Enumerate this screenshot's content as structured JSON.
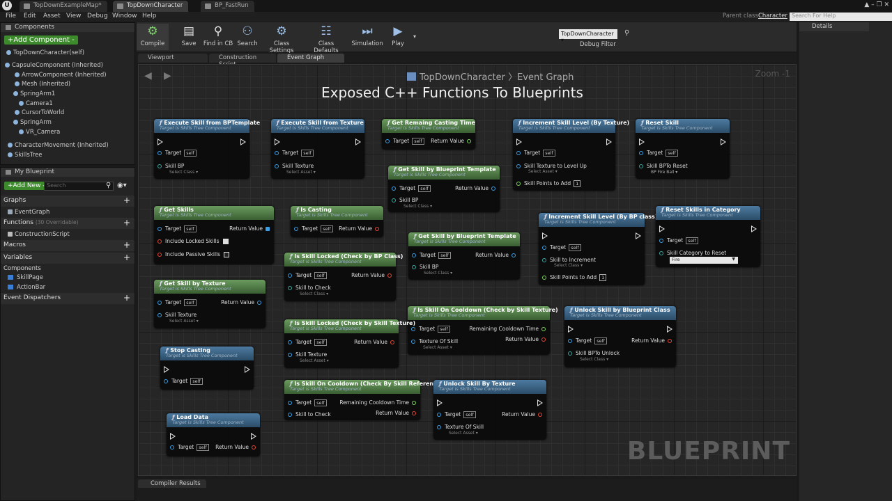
{
  "window": {
    "tabs": [
      "TopDownExampleMap*",
      "TopDownCharacter",
      "BP_FastRun"
    ],
    "controls": "▲ – ❐ ✕"
  },
  "menu": [
    "File",
    "Edit",
    "Asset",
    "View",
    "Debug",
    "Window",
    "Help"
  ],
  "parent_class_label": "Parent class:",
  "parent_class_value": "Character",
  "search_help_placeholder": "Search For Help",
  "components": {
    "title": "Components",
    "add_button": "+Add Component -",
    "items": [
      "TopDownCharacter(self)",
      "CapsuleComponent (Inherited)",
      "ArrowComponent (Inherited)",
      "Mesh (Inherited)",
      "SpringArm1",
      "Camera1",
      "CursorToWorld",
      "SpringArm",
      "VR_Camera",
      "CharacterMovement (Inherited)",
      "SkillsTree"
    ]
  },
  "my_blueprint": {
    "title": "My Blueprint",
    "add_new": "+Add New -",
    "search_placeholder": "Search",
    "graphs": "Graphs",
    "event_graph": "EventGraph",
    "functions": "Functions",
    "functions_sub": "(30 Overridable)",
    "construction_script": "ConstructionScript",
    "macros": "Macros",
    "variables": "Variables",
    "components": "Components",
    "vars": [
      "SkillPage",
      "ActionBar"
    ],
    "event_dispatchers": "Event Dispatchers"
  },
  "toolbar": {
    "compile": "Compile",
    "save": "Save",
    "find_in_cb": "Find in CB",
    "search": "Search",
    "class_settings": "Class Settings",
    "class_defaults": "Class Defaults",
    "simulation": "Simulation",
    "play": "Play",
    "debug_value": "TopDownCharacter ▾",
    "debug_label": "Debug Filter"
  },
  "editor_tabs": [
    "Viewport",
    "Construction Script",
    "Event Graph"
  ],
  "graph": {
    "breadcrumb": "TopDownCharacter 〉Event Graph",
    "zoom": "Zoom -1",
    "overlay_title": "Exposed C++ Functions To Blueprints",
    "watermark": "BLUEPRINT"
  },
  "node_subtitle": "Target is Skills Tree Component",
  "common": {
    "target": "Target",
    "self": "self",
    "return_value": "Return Value",
    "select_class": "Select Class ▾",
    "select_asset": "Select Asset ▾"
  },
  "nodes": {
    "execute_bp": {
      "title": "Execute Skill from BPTemplate",
      "pin": "Skill BP"
    },
    "execute_tex": {
      "title": "Execute Skill from Texture",
      "pin": "Skill Texture"
    },
    "remaining_time": {
      "title": "Get Remaing Casting Time"
    },
    "get_by_bp1": {
      "title": "Get Skill by Blueprint Template",
      "pin": "Skill BP"
    },
    "increment_tex": {
      "title": "Increment Skill Level (By Texture)",
      "pin1": "Skill Texture to Level Up",
      "pin2": "Skill Points to Add",
      "num": "1"
    },
    "reset_skill": {
      "title": "Reset Skill",
      "pin": "Skill BPTo Reset",
      "value": "BP Fire Ball ▾"
    },
    "get_skills": {
      "title": "Get Skills",
      "pin1": "Include Locked Skills",
      "pin2": "Include Passive Skills"
    },
    "is_casting": {
      "title": "Is Casting"
    },
    "increment_bp": {
      "title": "Increment Skill Level (By BP class)",
      "pin1": "Skill to Increment",
      "pin2": "Skill Points to Add",
      "num": "1"
    },
    "reset_category": {
      "title": "Reset Skills in Category",
      "pin": "Skill Category to Reset",
      "value": "Fire"
    },
    "get_by_bp2": {
      "title": "Get Skill by Blueprint Template",
      "pin": "Skill BP"
    },
    "locked_bp": {
      "title": "Is Skill Locked (Check by BP Class)",
      "pin": "Skill to Check"
    },
    "get_by_tex": {
      "title": "Get Skill by Texture",
      "pin": "Skill Texture"
    },
    "cooldown_tex": {
      "title": "Is Skill On Cooldown (Check by Skill Texture)",
      "pin": "Texture Of Skill",
      "rc": "Remaining Cooldown Time"
    },
    "unlock_bp": {
      "title": "Unlock Skill by Blueprint Class",
      "pin": "Skill BPTo Unlock"
    },
    "locked_tex": {
      "title": "Is Skill Locked (Check by Skill Texture)",
      "pin": "Skill Texture"
    },
    "stop_casting": {
      "title": "Stop Casting"
    },
    "cooldown_ref": {
      "title": "Is Skill On Cooldown (Check By Skill Reference)",
      "pin": "Skill to Check",
      "rc": "Remaining Cooldown Time"
    },
    "unlock_tex": {
      "title": "Unlock Skill By Texture",
      "pin": "Texture Of Skill"
    },
    "load_data": {
      "title": "Load Data"
    }
  },
  "compiler_results": "Compiler Results",
  "details": "Details"
}
